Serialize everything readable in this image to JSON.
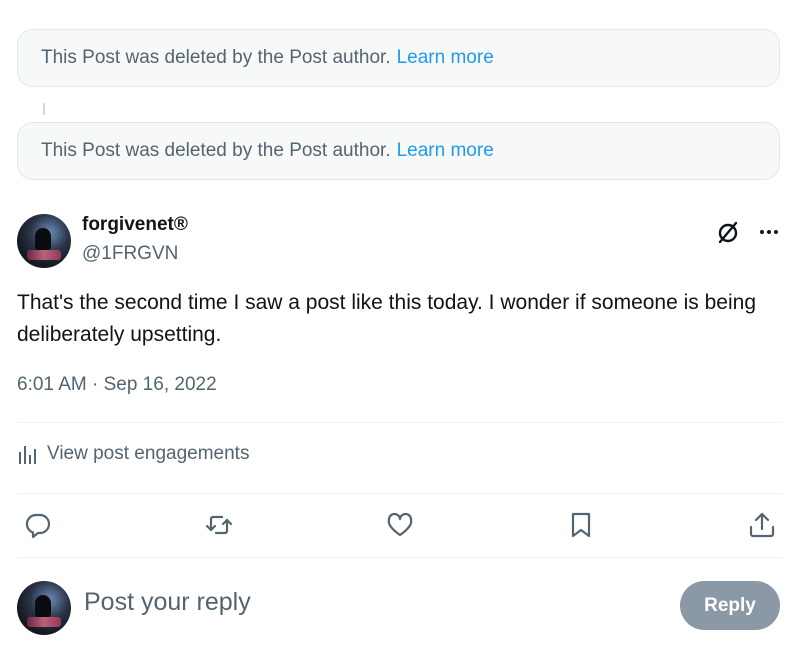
{
  "deleted_posts": [
    {
      "text": "This Post was deleted by the Post author.",
      "link": "Learn more"
    },
    {
      "text": "This Post was deleted by the Post author.",
      "link": "Learn more"
    }
  ],
  "post": {
    "author_name": "forgivenet®",
    "author_handle": "@1FRGVN",
    "text": "That's the second time I saw a post like this today. I wonder if someone is being deliberately upsetting.",
    "timestamp": "6:01 AM · Sep 16, 2022",
    "engagements_label": "View post engagements"
  },
  "actions": [
    "reply-icon",
    "repost-icon",
    "like-icon",
    "bookmark-icon",
    "share-icon"
  ],
  "composer": {
    "placeholder": "Post your reply",
    "button_label": "Reply"
  },
  "colors": {
    "link": "#1d9bf0",
    "secondary_text": "#536471",
    "reply_button_disabled": "#8b98a5"
  }
}
